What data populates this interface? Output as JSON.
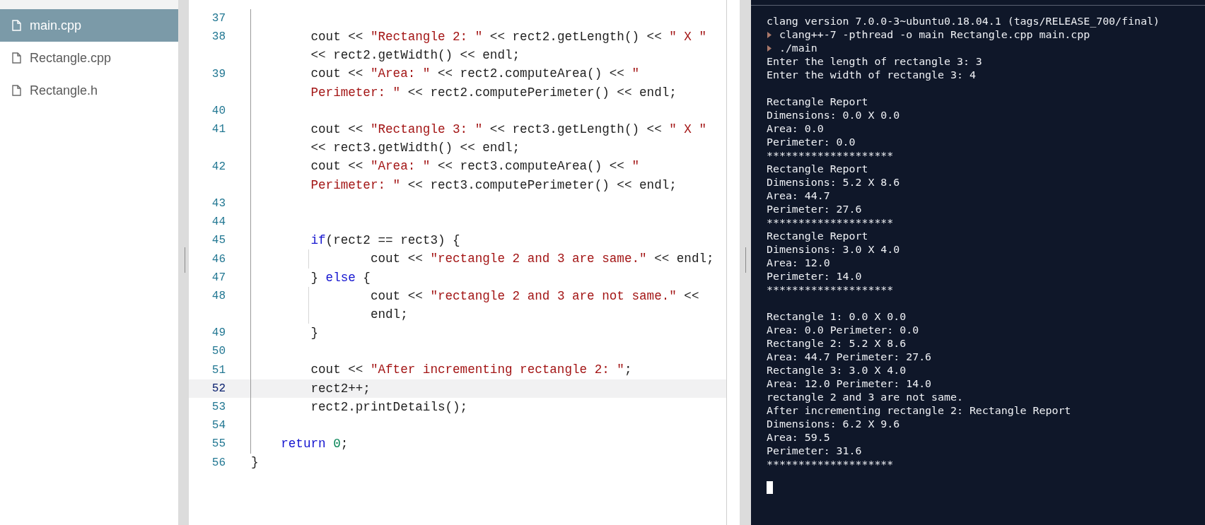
{
  "sidebar": {
    "files": [
      {
        "name": "main.cpp",
        "selected": true
      },
      {
        "name": "Rectangle.cpp",
        "selected": false
      },
      {
        "name": "Rectangle.h",
        "selected": false
      }
    ]
  },
  "editor": {
    "lines": [
      {
        "number": "37",
        "active": false
      },
      {
        "number": "38",
        "active": false,
        "rows": [
          [
            {
              "kind": "plain",
              "text": "        cout << "
            },
            {
              "kind": "string",
              "text": "\"Rectangle 2: \""
            },
            {
              "kind": "plain",
              "text": " << rect2.getLength() << "
            },
            {
              "kind": "string",
              "text": "\" X \""
            }
          ],
          [
            {
              "kind": "plain",
              "text": "<< rect2.getWidth() << endl;"
            }
          ]
        ]
      },
      {
        "number": "39",
        "active": false,
        "rows": [
          [
            {
              "kind": "plain",
              "text": "        cout << "
            },
            {
              "kind": "string",
              "text": "\"Area: \""
            },
            {
              "kind": "plain",
              "text": " << rect2.computeArea() << "
            },
            {
              "kind": "string",
              "text": "\""
            }
          ],
          [
            {
              "kind": "string",
              "text": "Perimeter: \""
            },
            {
              "kind": "plain",
              "text": " << rect2.computePerimeter() << endl;"
            }
          ]
        ]
      },
      {
        "number": "40",
        "active": false
      },
      {
        "number": "41",
        "active": false,
        "rows": [
          [
            {
              "kind": "plain",
              "text": "        cout << "
            },
            {
              "kind": "string",
              "text": "\"Rectangle 3: \""
            },
            {
              "kind": "plain",
              "text": " << rect3.getLength() << "
            },
            {
              "kind": "string",
              "text": "\" X \""
            }
          ],
          [
            {
              "kind": "plain",
              "text": "<< rect3.getWidth() << endl;"
            }
          ]
        ]
      },
      {
        "number": "42",
        "active": false,
        "rows": [
          [
            {
              "kind": "plain",
              "text": "        cout << "
            },
            {
              "kind": "string",
              "text": "\"Area: \""
            },
            {
              "kind": "plain",
              "text": " << rect3.computeArea() << "
            },
            {
              "kind": "string",
              "text": "\""
            }
          ],
          [
            {
              "kind": "string",
              "text": "Perimeter: \""
            },
            {
              "kind": "plain",
              "text": " << rect3.computePerimeter() << endl;"
            }
          ]
        ]
      },
      {
        "number": "43",
        "active": false
      },
      {
        "number": "44",
        "active": false
      },
      {
        "number": "45",
        "active": false,
        "rows": [
          [
            {
              "kind": "plain",
              "text": "        "
            },
            {
              "kind": "keyword",
              "text": "if"
            },
            {
              "kind": "plain",
              "text": "(rect2 == rect3) {"
            }
          ]
        ]
      },
      {
        "number": "46",
        "active": false,
        "rows": [
          [
            {
              "kind": "plain",
              "text": "                cout << "
            },
            {
              "kind": "string",
              "text": "\"rectangle 2 and 3 are same.\""
            },
            {
              "kind": "plain",
              "text": " << endl;"
            }
          ]
        ]
      },
      {
        "number": "47",
        "active": false,
        "rows": [
          [
            {
              "kind": "plain",
              "text": "        } "
            },
            {
              "kind": "keyword",
              "text": "else"
            },
            {
              "kind": "plain",
              "text": " {"
            }
          ]
        ]
      },
      {
        "number": "48",
        "active": false,
        "rows": [
          [
            {
              "kind": "plain",
              "text": "                cout << "
            },
            {
              "kind": "string",
              "text": "\"rectangle 2 and 3 are not same.\""
            },
            {
              "kind": "plain",
              "text": " <<"
            }
          ],
          [
            {
              "kind": "plain",
              "text": "endl;"
            }
          ]
        ]
      },
      {
        "number": "49",
        "active": false,
        "rows": [
          [
            {
              "kind": "plain",
              "text": "        }"
            }
          ]
        ]
      },
      {
        "number": "50",
        "active": false
      },
      {
        "number": "51",
        "active": false,
        "rows": [
          [
            {
              "kind": "plain",
              "text": "        cout << "
            },
            {
              "kind": "string",
              "text": "\"After incrementing rectangle 2: \""
            },
            {
              "kind": "plain",
              "text": ";"
            }
          ]
        ]
      },
      {
        "number": "52",
        "active": true,
        "rows": [
          [
            {
              "kind": "plain",
              "text": "        rect2++;"
            }
          ]
        ]
      },
      {
        "number": "53",
        "active": false,
        "rows": [
          [
            {
              "kind": "plain",
              "text": "        rect2.printDetails();"
            }
          ]
        ]
      },
      {
        "number": "54",
        "active": false
      },
      {
        "number": "55",
        "active": false,
        "rows": [
          [
            {
              "kind": "plain",
              "text": "    "
            },
            {
              "kind": "keyword",
              "text": "return"
            },
            {
              "kind": "plain",
              "text": " "
            },
            {
              "kind": "number",
              "text": "0"
            },
            {
              "kind": "plain",
              "text": ";"
            }
          ]
        ]
      },
      {
        "number": "56",
        "active": false,
        "rows": [
          [
            {
              "kind": "plain",
              "text": "}"
            }
          ]
        ]
      }
    ]
  },
  "terminal": {
    "cursor": true,
    "lines": [
      {
        "kind": "output",
        "text": "clang version 7.0.0-3~ubuntu0.18.04.1 (tags/RELEASE_700/final)"
      },
      {
        "kind": "command",
        "text": "clang++-7 -pthread -o main Rectangle.cpp main.cpp"
      },
      {
        "kind": "command",
        "text": "./main"
      },
      {
        "kind": "output",
        "text": "Enter the length of rectangle 3: 3"
      },
      {
        "kind": "output",
        "text": "Enter the width of rectangle 3: 4"
      },
      {
        "kind": "blank"
      },
      {
        "kind": "output",
        "text": "Rectangle Report"
      },
      {
        "kind": "output",
        "text": "Dimensions: 0.0 X 0.0"
      },
      {
        "kind": "output",
        "text": "Area: 0.0"
      },
      {
        "kind": "output",
        "text": "Perimeter: 0.0"
      },
      {
        "kind": "output",
        "text": "********************"
      },
      {
        "kind": "output",
        "text": "Rectangle Report"
      },
      {
        "kind": "output",
        "text": "Dimensions: 5.2 X 8.6"
      },
      {
        "kind": "output",
        "text": "Area: 44.7"
      },
      {
        "kind": "output",
        "text": "Perimeter: 27.6"
      },
      {
        "kind": "output",
        "text": "********************"
      },
      {
        "kind": "output",
        "text": "Rectangle Report"
      },
      {
        "kind": "output",
        "text": "Dimensions: 3.0 X 4.0"
      },
      {
        "kind": "output",
        "text": "Area: 12.0"
      },
      {
        "kind": "output",
        "text": "Perimeter: 14.0"
      },
      {
        "kind": "output",
        "text": "********************"
      },
      {
        "kind": "blank"
      },
      {
        "kind": "output",
        "text": "Rectangle 1: 0.0 X 0.0"
      },
      {
        "kind": "output",
        "text": "Area: 0.0 Perimeter: 0.0"
      },
      {
        "kind": "output",
        "text": "Rectangle 2: 5.2 X 8.6"
      },
      {
        "kind": "output",
        "text": "Area: 44.7 Perimeter: 27.6"
      },
      {
        "kind": "output",
        "text": "Rectangle 3: 3.0 X 4.0"
      },
      {
        "kind": "output",
        "text": "Area: 12.0 Perimeter: 14.0"
      },
      {
        "kind": "output",
        "text": "rectangle 2 and 3 are not same."
      },
      {
        "kind": "output",
        "text": "After incrementing rectangle 2: Rectangle Report"
      },
      {
        "kind": "output",
        "text": "Dimensions: 6.2 X 9.6"
      },
      {
        "kind": "output",
        "text": "Area: 59.5"
      },
      {
        "kind": "output",
        "text": "Perimeter: 31.6"
      },
      {
        "kind": "output",
        "text": "********************"
      }
    ]
  }
}
